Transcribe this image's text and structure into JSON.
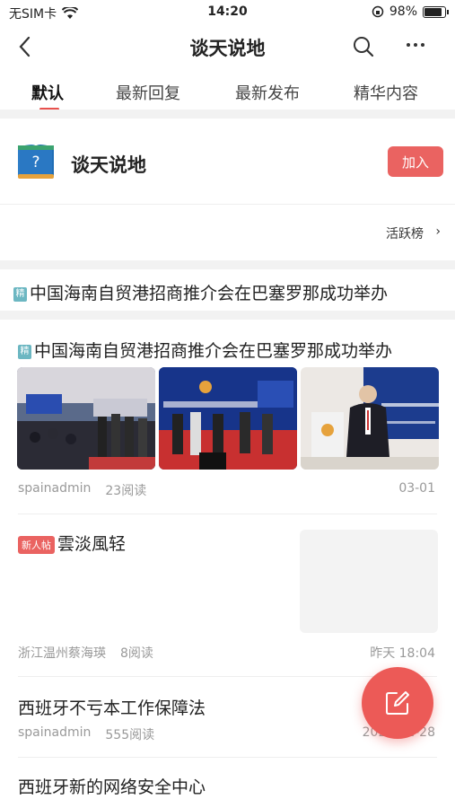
{
  "status_bar": {
    "carrier": "无SIM卡",
    "time": "14:20",
    "battery": "98%"
  },
  "nav": {
    "title": "谈天说地"
  },
  "tabs": [
    {
      "label": "默认",
      "active": true
    },
    {
      "label": "最新回复"
    },
    {
      "label": "最新发布"
    },
    {
      "label": "精华内容"
    }
  ],
  "forum": {
    "name": "谈天说地",
    "join_label": "加入",
    "ranking_label": "活跃榜"
  },
  "pinned": {
    "badge": "精",
    "title": "中国海南自贸港招商推介会在巴塞罗那成功举办"
  },
  "posts": [
    {
      "badge": "精",
      "title": "中国海南自贸港招商推介会在巴塞罗那成功举办",
      "author": "spainadmin",
      "reads": "23阅读",
      "date": "03-01"
    },
    {
      "badge": "新人帖",
      "title": "雲淡風轻",
      "author": "浙江温州蔡海瑛",
      "reads": "8阅读",
      "date": "昨天 18:04"
    },
    {
      "title": "西班牙不亏本工作保障法",
      "author": "spainadmin",
      "reads": "555阅读",
      "date": "2022-12-28"
    },
    {
      "title": "西班牙新的网络安全中心"
    }
  ],
  "colors": {
    "accent": "#ea6361",
    "jing": "#6cb7c2"
  }
}
